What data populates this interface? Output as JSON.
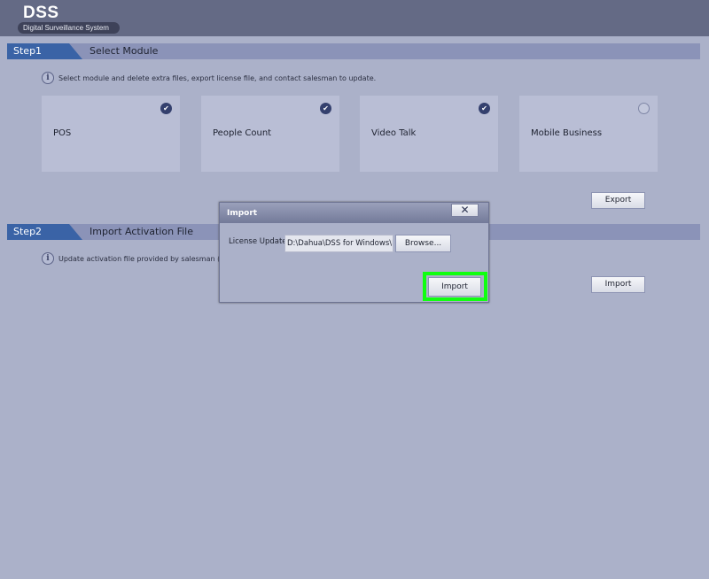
{
  "header": {
    "logo": "DSS",
    "tagline": "Digital Surveillance System"
  },
  "step1": {
    "number": "Step1",
    "title": "Select Module",
    "info": "Select module and delete extra files, export license file, and contact salesman to update.",
    "modules": [
      {
        "label": "POS",
        "checked": true
      },
      {
        "label": "People Count",
        "checked": true
      },
      {
        "label": "Video Talk",
        "checked": true
      },
      {
        "label": "Mobile Business",
        "checked": false
      }
    ],
    "export_label": "Export"
  },
  "step2": {
    "number": "Step2",
    "title": "Import Activation File",
    "info": "Update activation file provided by salesman (su",
    "import_label": "Import"
  },
  "dialog": {
    "title": "Import",
    "close_label": "✕",
    "field_label": "License Update :",
    "field_value": "D:\\Dahua\\DSS for Windows\\DSS",
    "browse_label": "Browse...",
    "import_label": "Import",
    "highlight_color": "#10ff10"
  }
}
